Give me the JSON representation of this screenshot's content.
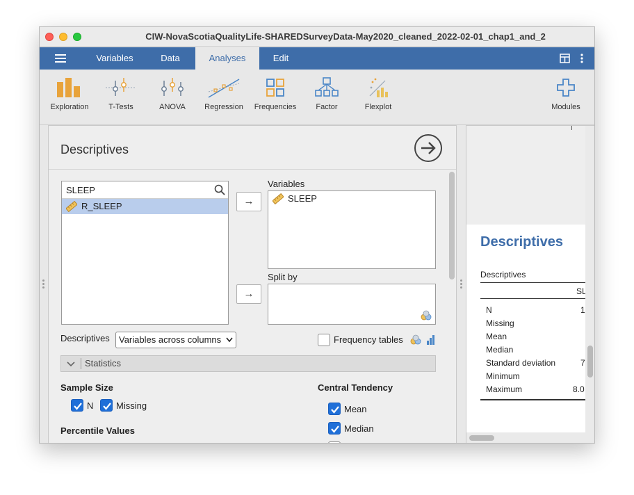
{
  "window": {
    "title": "CIW-NovaScotiaQualityLife-SHAREDSurveyData-May2020_cleaned_2022-02-01_chap1_and_2"
  },
  "menubar": {
    "tabs": [
      {
        "label": "Variables"
      },
      {
        "label": "Data"
      },
      {
        "label": "Analyses"
      },
      {
        "label": "Edit"
      }
    ],
    "active_tab": "Analyses",
    "accent_color": "#3e6da9"
  },
  "ribbon": {
    "items": [
      {
        "label": "Exploration",
        "icon": "exploration-icon"
      },
      {
        "label": "T-Tests",
        "icon": "t-tests-icon"
      },
      {
        "label": "ANOVA",
        "icon": "anova-icon"
      },
      {
        "label": "Regression",
        "icon": "regression-icon"
      },
      {
        "label": "Frequencies",
        "icon": "frequencies-icon"
      },
      {
        "label": "Factor",
        "icon": "factor-icon"
      },
      {
        "label": "Flexplot",
        "icon": "flexplot-icon"
      }
    ],
    "modules_label": "Modules"
  },
  "analysis": {
    "title": "Descriptives",
    "search_value": "SLEEP",
    "available_vars": [
      {
        "name": "R_SLEEP"
      }
    ],
    "variables_label": "Variables",
    "variables": [
      {
        "name": "SLEEP"
      }
    ],
    "split_by_label": "Split by",
    "descriptives_label": "Descriptives",
    "descriptives_option": "Variables across columns",
    "frequency_tables_label": "Frequency tables",
    "frequency_tables_checked": false,
    "statistics_label": "Statistics",
    "sample_size_label": "Sample Size",
    "n_label": "N",
    "n_checked": true,
    "missing_label": "Missing",
    "missing_checked": true,
    "percentile_label": "Percentile Values",
    "central_tendency_label": "Central Tendency",
    "mean_label": "Mean",
    "mean_checked": true,
    "median_label": "Median",
    "median_checked": true
  },
  "results": {
    "title": "Descriptives",
    "table_caption": "Descriptives",
    "column_header": "SL",
    "rows": [
      {
        "label": "N",
        "value": "1"
      },
      {
        "label": "Missing",
        "value": ""
      },
      {
        "label": "Mean",
        "value": ""
      },
      {
        "label": "Median",
        "value": ""
      },
      {
        "label": "Standard deviation",
        "value": "7"
      },
      {
        "label": "Minimum",
        "value": ""
      },
      {
        "label": "Maximum",
        "value": "8.0"
      }
    ]
  }
}
